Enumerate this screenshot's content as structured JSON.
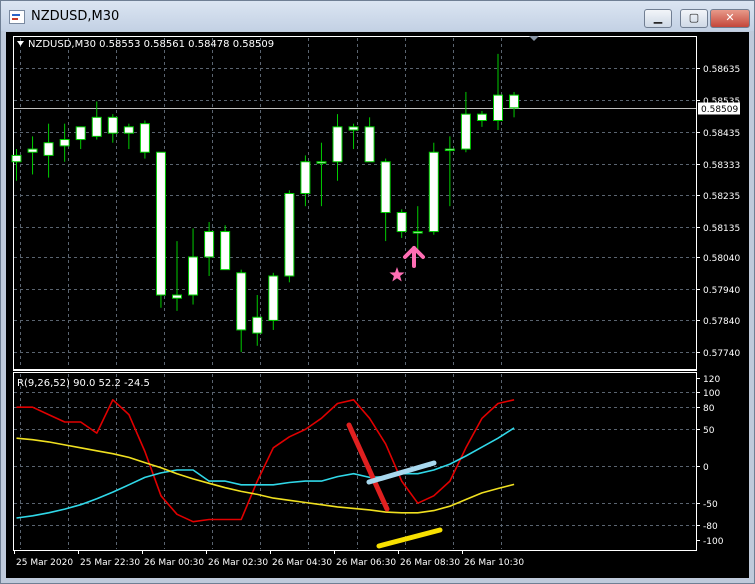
{
  "window": {
    "title": "NZDUSD,M30",
    "minimize_label": "▁",
    "maximize_label": "▢",
    "close_label": "✕",
    "icons": [
      "chart-app-icon",
      "minimize-icon",
      "maximize-icon",
      "close-icon"
    ]
  },
  "colors": {
    "background": "#000000",
    "grid": "#5a6470",
    "text": "#ffffff",
    "candle_up": "#00cc00",
    "candle_body": "#ffffff",
    "current_price_line": "#c0c0c0",
    "indicator_fast": "#e00000",
    "indicator_medium": "#30d8e8",
    "indicator_slow": "#f0e020",
    "annotation_red": "#e02020",
    "annotation_blue": "#a8d8ee",
    "annotation_yellow": "#f8e000",
    "annotation_pink": "#ff6eb4"
  },
  "chart_data": [
    {
      "type": "candlestick",
      "legend": "NZDUSD,M30  0.58553 0.58561 0.58478 0.58509",
      "ylim": [
        0.5769,
        0.5873
      ],
      "y_ticks": [
        "0.58635",
        "0.58535",
        "0.58435",
        "0.58333",
        "0.58235",
        "0.58135",
        "0.58040",
        "0.57940",
        "0.57840",
        "0.57740"
      ],
      "current_price": 0.58509,
      "current_price_label": "0.58509",
      "candles": [
        {
          "o": 0.5836,
          "h": 0.5838,
          "l": 0.5828,
          "c": 0.5834
        },
        {
          "o": 0.5837,
          "h": 0.5842,
          "l": 0.583,
          "c": 0.5838
        },
        {
          "o": 0.5836,
          "h": 0.5846,
          "l": 0.5829,
          "c": 0.584
        },
        {
          "o": 0.5839,
          "h": 0.5846,
          "l": 0.5834,
          "c": 0.5841
        },
        {
          "o": 0.5841,
          "h": 0.5845,
          "l": 0.5838,
          "c": 0.5845
        },
        {
          "o": 0.5842,
          "h": 0.5853,
          "l": 0.5841,
          "c": 0.5848
        },
        {
          "o": 0.5848,
          "h": 0.5849,
          "l": 0.584,
          "c": 0.5843
        },
        {
          "o": 0.5843,
          "h": 0.5846,
          "l": 0.5838,
          "c": 0.5845
        },
        {
          "o": 0.5846,
          "h": 0.5847,
          "l": 0.5835,
          "c": 0.5837
        },
        {
          "o": 0.5837,
          "h": 0.5837,
          "l": 0.5788,
          "c": 0.5792
        },
        {
          "o": 0.5792,
          "h": 0.5809,
          "l": 0.5787,
          "c": 0.5791
        },
        {
          "o": 0.5792,
          "h": 0.5813,
          "l": 0.5789,
          "c": 0.5804
        },
        {
          "o": 0.5804,
          "h": 0.5815,
          "l": 0.5798,
          "c": 0.5812
        },
        {
          "o": 0.5812,
          "h": 0.5814,
          "l": 0.58,
          "c": 0.58
        },
        {
          "o": 0.5799,
          "h": 0.58,
          "l": 0.5774,
          "c": 0.5781
        },
        {
          "o": 0.578,
          "h": 0.5792,
          "l": 0.5776,
          "c": 0.5785
        },
        {
          "o": 0.5784,
          "h": 0.5799,
          "l": 0.5781,
          "c": 0.5798
        },
        {
          "o": 0.5798,
          "h": 0.5825,
          "l": 0.5796,
          "c": 0.5824
        },
        {
          "o": 0.5824,
          "h": 0.5836,
          "l": 0.582,
          "c": 0.5834
        },
        {
          "o": 0.5834,
          "h": 0.584,
          "l": 0.582,
          "c": 0.5834
        },
        {
          "o": 0.5834,
          "h": 0.5849,
          "l": 0.5828,
          "c": 0.5845
        },
        {
          "o": 0.5845,
          "h": 0.5846,
          "l": 0.5838,
          "c": 0.5844
        },
        {
          "o": 0.5845,
          "h": 0.5848,
          "l": 0.5834,
          "c": 0.5834
        },
        {
          "o": 0.5834,
          "h": 0.5835,
          "l": 0.5809,
          "c": 0.5818
        },
        {
          "o": 0.5818,
          "h": 0.5819,
          "l": 0.581,
          "c": 0.5812
        },
        {
          "o": 0.5812,
          "h": 0.582,
          "l": 0.5806,
          "c": 0.5812
        },
        {
          "o": 0.5812,
          "h": 0.584,
          "l": 0.5811,
          "c": 0.5837
        },
        {
          "o": 0.5838,
          "h": 0.5842,
          "l": 0.582,
          "c": 0.5838
        },
        {
          "o": 0.5838,
          "h": 0.5856,
          "l": 0.5837,
          "c": 0.5849
        },
        {
          "o": 0.5849,
          "h": 0.585,
          "l": 0.5845,
          "c": 0.5847
        },
        {
          "o": 0.5847,
          "h": 0.5868,
          "l": 0.5844,
          "c": 0.5855
        },
        {
          "o": 0.5855,
          "h": 0.5856,
          "l": 0.5848,
          "c": 0.5851
        }
      ]
    },
    {
      "type": "line",
      "legend": "R(9,26,52) 90.0 52.2 -24.5",
      "ylim": [
        -112,
        125
      ],
      "y_ticks": [
        120,
        100,
        80,
        50,
        0,
        -50,
        -80,
        -100
      ],
      "x_tick_labels": [
        "25 Mar 2020",
        "25 Mar 22:30",
        "26 Mar 00:30",
        "26 Mar 02:30",
        "26 Mar 04:30",
        "26 Mar 06:30",
        "26 Mar 08:30",
        "26 Mar 10:30"
      ],
      "series": [
        {
          "color": "#e00000",
          "values": [
            80,
            80,
            70,
            60,
            60,
            45,
            90,
            70,
            20,
            -40,
            -65,
            -75,
            -72,
            -72,
            -72,
            -20,
            25,
            40,
            50,
            65,
            85,
            90,
            65,
            30,
            -20,
            -50,
            -40,
            -20,
            25,
            65,
            85,
            90
          ]
        },
        {
          "color": "#30d8e8",
          "values": [
            -70,
            -67,
            -63,
            -58,
            -52,
            -44,
            -35,
            -25,
            -15,
            -9,
            -5,
            -5,
            -20,
            -20,
            -25,
            -25,
            -25,
            -22,
            -20,
            -20,
            -14,
            -10,
            -15,
            -14,
            -10,
            -10,
            -5,
            3,
            14,
            26,
            38,
            52
          ]
        },
        {
          "color": "#f0e020",
          "values": [
            38,
            36,
            33,
            29,
            25,
            21,
            17,
            12,
            5,
            -2,
            -10,
            -17,
            -23,
            -29,
            -34,
            -38,
            -43,
            -46,
            -49,
            -52,
            -55,
            -57,
            -59,
            -62,
            -63,
            -63,
            -60,
            -54,
            -45,
            -36,
            -30,
            -24.5
          ]
        }
      ]
    }
  ]
}
